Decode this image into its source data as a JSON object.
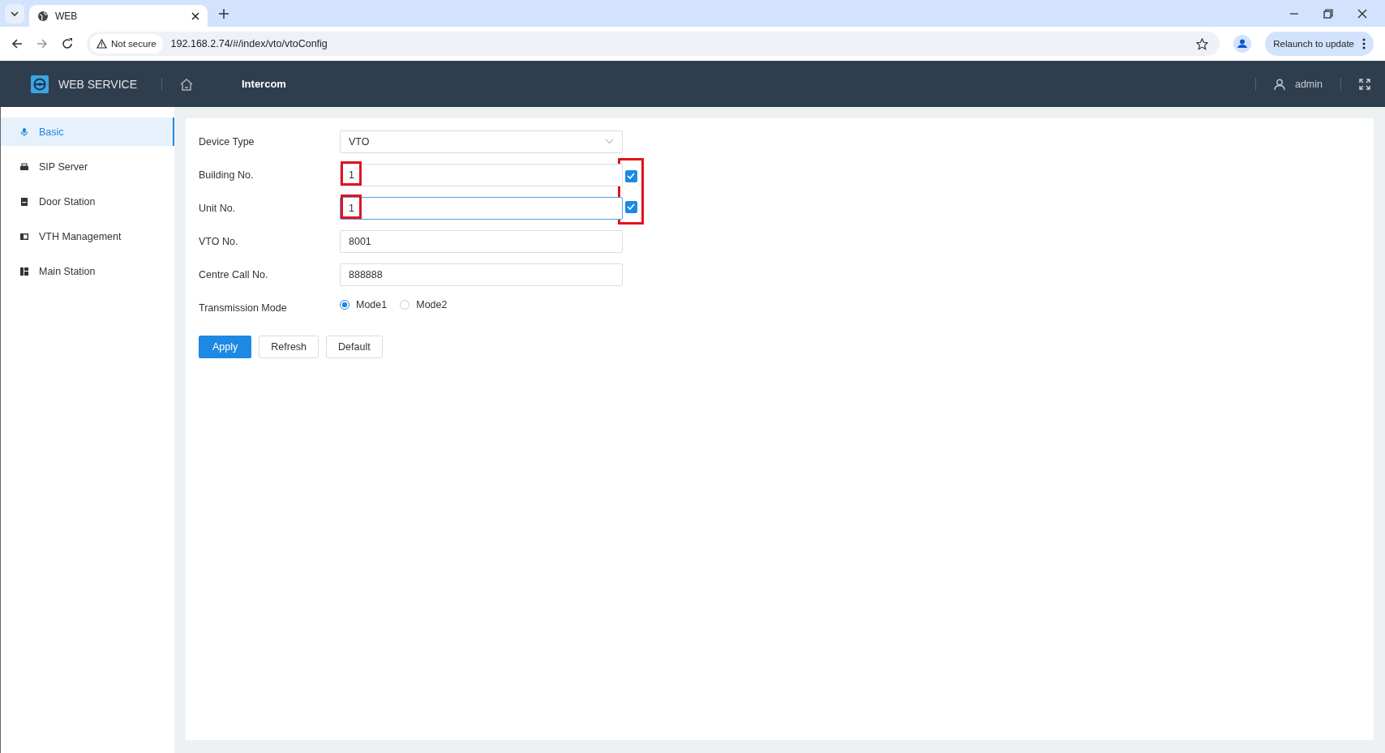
{
  "browser": {
    "tab_title": "WEB",
    "security": "Not secure",
    "address": "192.168.2.74/#/index/vto/vtoConfig",
    "relaunch": "Relaunch to update"
  },
  "header": {
    "brand": "WEB SERVICE",
    "section": "Intercom",
    "user": "admin"
  },
  "sidebar": {
    "items": [
      {
        "label": "Basic",
        "selected": true
      },
      {
        "label": "SIP Server",
        "selected": false
      },
      {
        "label": "Door Station",
        "selected": false
      },
      {
        "label": "VTH Management",
        "selected": false
      },
      {
        "label": "Main Station",
        "selected": false
      }
    ]
  },
  "form": {
    "fields": [
      {
        "kind": "select",
        "label": "Device Type",
        "value": "VTO"
      },
      {
        "kind": "text",
        "label": "Building No.",
        "value": "1",
        "checked": true,
        "focused": false,
        "highlighted": true
      },
      {
        "kind": "text",
        "label": "Unit No.",
        "value": "1",
        "checked": true,
        "focused": true,
        "highlighted": true
      },
      {
        "kind": "text",
        "label": "VTO No.",
        "value": "8001",
        "focused": false,
        "highlighted": false
      },
      {
        "kind": "text",
        "label": "Centre Call No.",
        "value": "888888",
        "focused": false,
        "highlighted": false
      },
      {
        "kind": "radio",
        "label": "Transmission Mode",
        "options": [
          {
            "label": "Mode1",
            "selected": true
          },
          {
            "label": "Mode2",
            "selected": false
          }
        ]
      }
    ],
    "buttons": [
      {
        "label": "Apply",
        "kind": "primary"
      },
      {
        "label": "Refresh",
        "kind": "default"
      },
      {
        "label": "Default",
        "kind": "default"
      }
    ]
  }
}
